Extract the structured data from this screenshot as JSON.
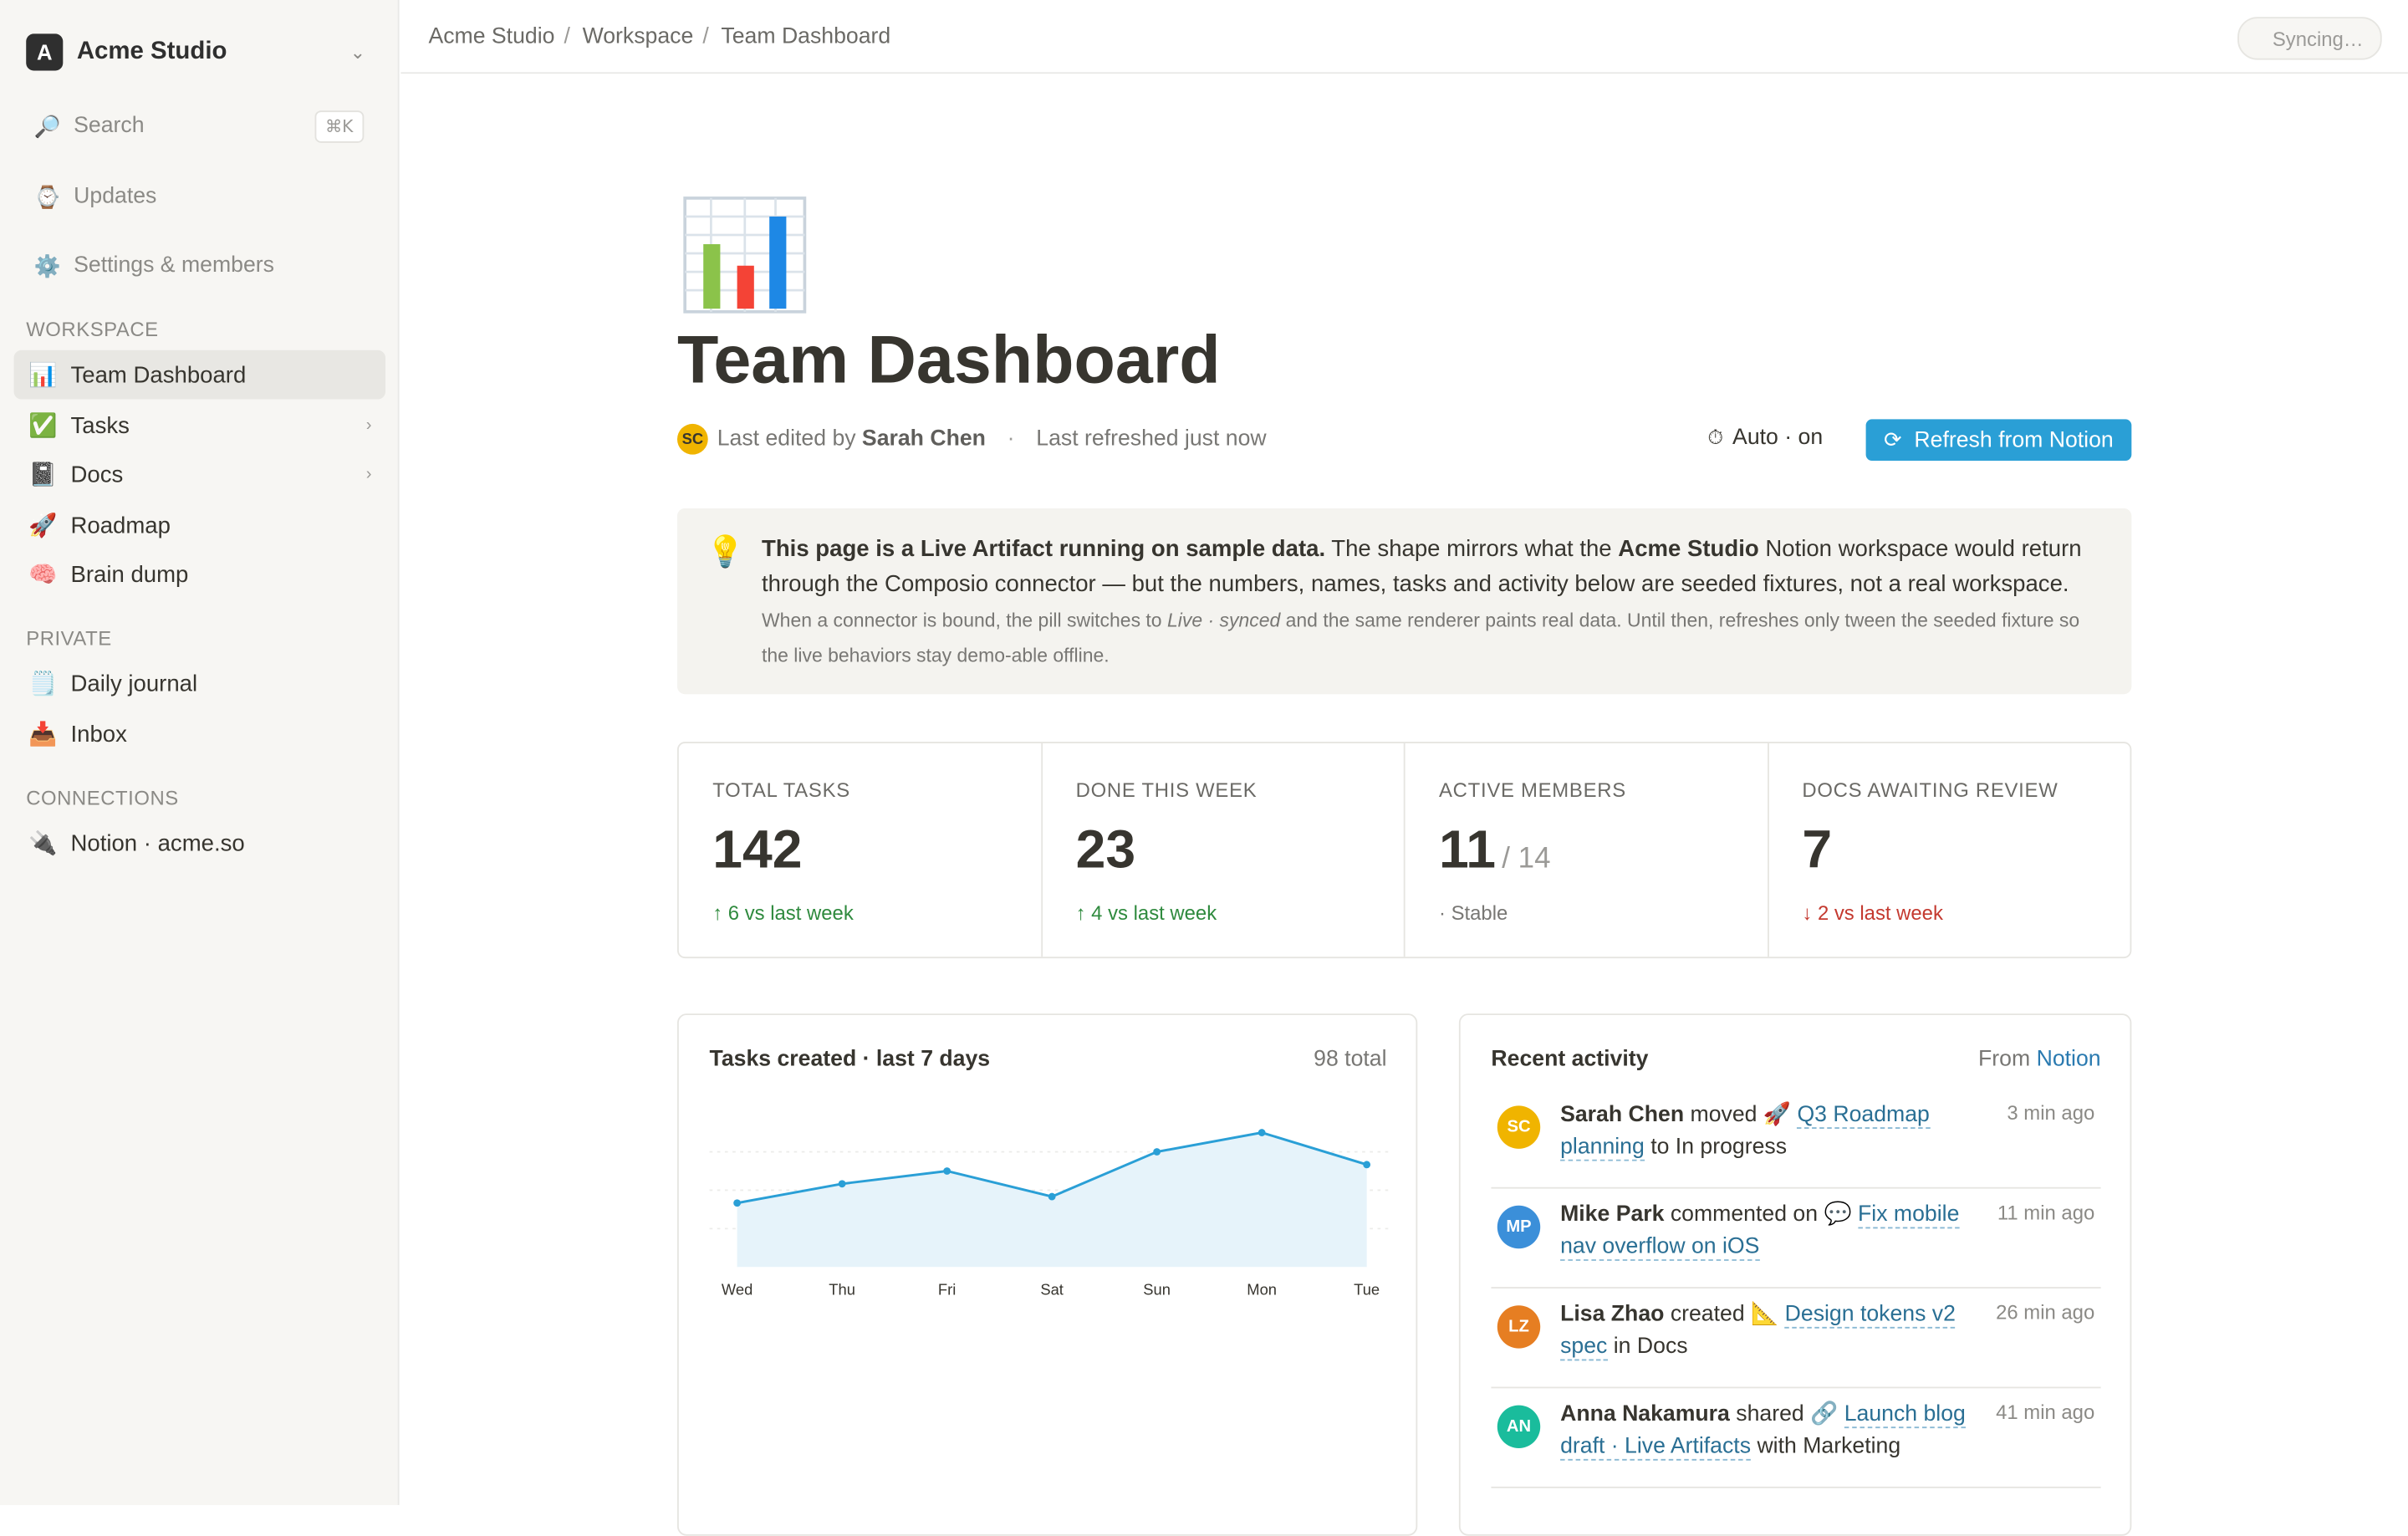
{
  "workspace": {
    "logo_letter": "A",
    "name": "Acme Studio"
  },
  "sidebar": {
    "search_label": "Search",
    "search_shortcut": "⌘K",
    "updates_label": "Updates",
    "settings_label": "Settings & members",
    "sections": [
      {
        "label": "WORKSPACE",
        "items": [
          {
            "icon": "📊",
            "icon_name": "bar-chart-icon",
            "label": "Team Dashboard",
            "active": true
          },
          {
            "icon": "✅",
            "icon_name": "check-icon",
            "label": "Tasks",
            "chevron": true
          },
          {
            "icon": "📓",
            "icon_name": "notebook-icon",
            "label": "Docs",
            "chevron": true
          },
          {
            "icon": "🚀",
            "icon_name": "rocket-icon",
            "label": "Roadmap"
          },
          {
            "icon": "🧠",
            "icon_name": "brain-icon",
            "label": "Brain dump"
          }
        ]
      },
      {
        "label": "PRIVATE",
        "items": [
          {
            "icon": "🗒️",
            "icon_name": "notepad-icon",
            "label": "Daily journal"
          },
          {
            "icon": "📥",
            "icon_name": "inbox-icon",
            "label": "Inbox"
          }
        ]
      },
      {
        "label": "CONNECTIONS",
        "items": [
          {
            "icon": "🔌",
            "icon_name": "plug-icon",
            "label": "Notion · acme.so"
          }
        ]
      }
    ]
  },
  "topbar": {
    "breadcrumbs": [
      "Acme Studio",
      "Workspace",
      "Team Dashboard"
    ],
    "sync_status": "Syncing…"
  },
  "page": {
    "icon": "bar-chart-icon",
    "title": "Team Dashboard",
    "editor_initials": "SC",
    "last_edited_prefix": "Last edited by",
    "last_edited_by": "Sarah Chen",
    "separator": "·",
    "last_refreshed": "Last refreshed just now",
    "auto_label": "Auto · on",
    "refresh_button": "Refresh from Notion"
  },
  "callout": {
    "icon": "lightbulb-icon",
    "lead_bold": "This page is a Live Artifact running on sample data.",
    "lead_1": " The shape mirrors what the ",
    "lead_brand": "Acme Studio",
    "lead_2": " Notion workspace would return through the Composio connector — but the numbers, names, tasks and activity below are seeded fixtures, not a real workspace.",
    "fine_1": "When a connector is bound, the pill switches to ",
    "fine_em_1": "Live",
    "fine_mid": " · ",
    "fine_em_2": "synced",
    "fine_2": " and the same renderer paints real data. Until then, refreshes only tween the seeded fixture so the live behaviors stay demo-able offline."
  },
  "stats": [
    {
      "label": "TOTAL TASKS",
      "value": "142",
      "sub": "",
      "delta": "↑  6 vs last week",
      "trend": "up"
    },
    {
      "label": "DONE THIS WEEK",
      "value": "23",
      "sub": "",
      "delta": "↑  4 vs last week",
      "trend": "up"
    },
    {
      "label": "ACTIVE MEMBERS",
      "value": "11",
      "sub": "/ 14",
      "delta": "· Stable",
      "trend": "flat"
    },
    {
      "label": "DOCS AWAITING REVIEW",
      "value": "7",
      "sub": "",
      "delta": "↓  2 vs last week",
      "trend": "down"
    }
  ],
  "chart_panel": {
    "title": "Tasks created · last 7 days",
    "total": "98 total"
  },
  "chart_data": {
    "type": "area",
    "title": "Tasks created · last 7 days",
    "categories": [
      "Wed",
      "Thu",
      "Fri",
      "Sat",
      "Sun",
      "Mon",
      "Tue"
    ],
    "values": [
      10,
      13,
      15,
      11,
      18,
      21,
      16
    ],
    "ylim": [
      0,
      24
    ],
    "grid": true,
    "color": "#2a9fd6",
    "fill": "#e6f3fa"
  },
  "activity": {
    "title": "Recent activity",
    "source_prefix": "From",
    "source_link": "Notion",
    "items": [
      {
        "initials": "SC",
        "color": "#f0b400",
        "user": "Sarah Chen",
        "action": "moved",
        "link_icon": "🚀",
        "link": "Q3 Roadmap planning",
        "tail": "to In progress",
        "time": "3 min ago"
      },
      {
        "initials": "MP",
        "color": "#3b8fd9",
        "user": "Mike Park",
        "action": "commented on",
        "link_icon": "💬",
        "link": "Fix mobile nav overflow on iOS",
        "tail": "",
        "time": "11 min ago"
      },
      {
        "initials": "LZ",
        "color": "#e67e22",
        "user": "Lisa Zhao",
        "action": "created",
        "link_icon": "📐",
        "link": "Design tokens v2 spec",
        "tail": "in Docs",
        "time": "26 min ago"
      },
      {
        "initials": "AN",
        "color": "#1abc9c",
        "user": "Anna Nakamura",
        "action": "shared",
        "link_icon": "🔗",
        "link": "Launch blog draft · Live Artifacts",
        "tail": "with Marketing",
        "time": "41 min ago"
      }
    ]
  }
}
